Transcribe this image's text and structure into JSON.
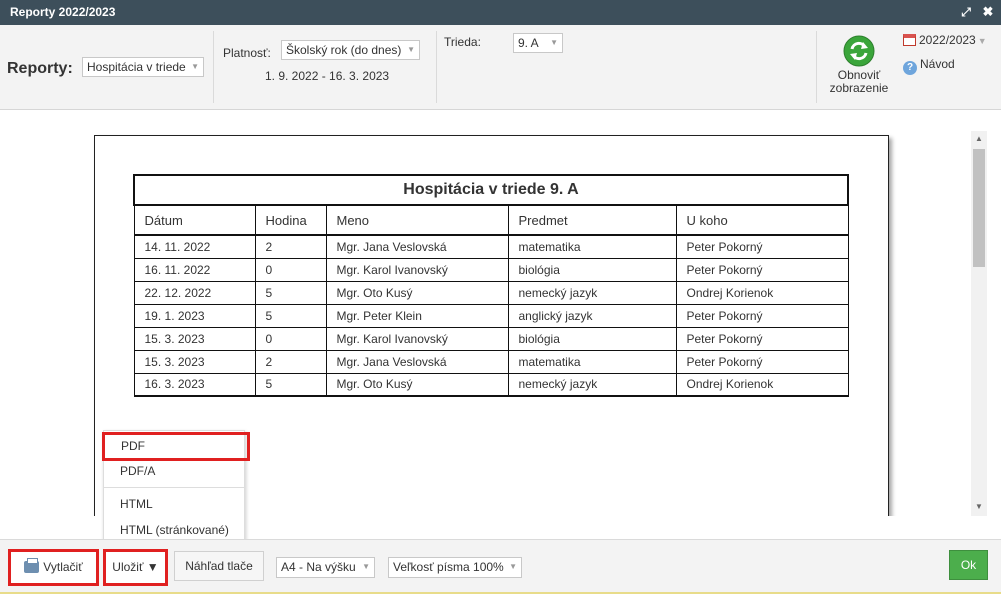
{
  "window": {
    "title": "Reporty 2022/2023",
    "maximize_glyph": "⤢",
    "close_glyph": "✖"
  },
  "toolbar": {
    "reporty_label": "Reporty:",
    "report_select": "Hospitácia v triede",
    "platnost_label": "Platnosť:",
    "platnost_select": "Školský rok (do dnes)",
    "date_range": "1. 9. 2022 - 16. 3. 2023",
    "trieda_label": "Trieda:",
    "trieda_select": "9. A",
    "refresh_line1": "Obnoviť",
    "refresh_line2": "zobrazenie",
    "year": "2022/2023",
    "help": "Návod"
  },
  "report": {
    "title": "Hospitácia v triede 9. A",
    "columns": [
      "Dátum",
      "Hodina",
      "Meno",
      "Predmet",
      "U koho"
    ],
    "rows": [
      [
        "14. 11. 2022",
        "2",
        "Mgr. Jana Veslovská",
        "matematika",
        "Peter Pokorný"
      ],
      [
        "16. 11. 2022",
        "0",
        "Mgr. Karol Ivanovský",
        "biológia",
        "Peter Pokorný"
      ],
      [
        "22. 12. 2022",
        "5",
        "Mgr. Oto Kusý",
        "nemecký jazyk",
        "Ondrej Korienok"
      ],
      [
        "19. 1. 2023",
        "5",
        "Mgr. Peter Klein",
        "anglický jazyk",
        "Peter Pokorný"
      ],
      [
        "15. 3. 2023",
        "0",
        "Mgr. Karol Ivanovský",
        "biológia",
        "Peter Pokorný"
      ],
      [
        "15. 3. 2023",
        "2",
        "Mgr. Jana Veslovská",
        "matematika",
        "Peter Pokorný"
      ],
      [
        "16. 3. 2023",
        "5",
        "Mgr. Oto Kusý",
        "nemecký jazyk",
        "Ondrej Korienok"
      ]
    ]
  },
  "save_menu": {
    "items": [
      "PDF",
      "PDF/A",
      "HTML",
      "HTML (stránkované)"
    ]
  },
  "bottombar": {
    "print_label": "Vytlačiť",
    "save_label": "Uložiť ▼",
    "preview_label": "Náhľad tlače",
    "format_select": "A4 - Na výšku",
    "font_select": "Veľkosť písma 100%",
    "ok_label": "Ok"
  },
  "colors": {
    "titlebar": "#3d4f5b",
    "highlight": "#e02020",
    "ok_button": "#4cae4c"
  }
}
